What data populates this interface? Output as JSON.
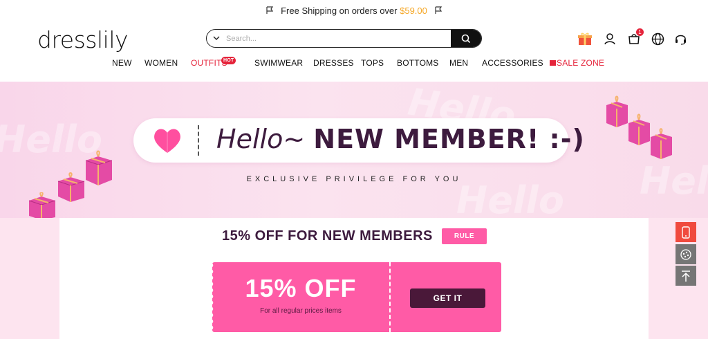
{
  "shipping": {
    "text": "Free Shipping on orders over",
    "amount": "$59.00"
  },
  "header": {
    "logo": "dresslily",
    "search": {
      "placeholder": "Search..."
    },
    "icons": [
      "gift-icon",
      "user-icon",
      "cart-icon",
      "globe-icon",
      "headset-icon"
    ],
    "cart_count": "1"
  },
  "nav": {
    "items": [
      {
        "label": "NEW"
      },
      {
        "label": "WOMEN"
      },
      {
        "label": "OUTFITS",
        "badge": "HOT"
      },
      {
        "label": "SWIMWEAR"
      },
      {
        "label": "DRESSES"
      },
      {
        "label": "TOPS"
      },
      {
        "label": "BOTTOMS"
      },
      {
        "label": "MEN"
      },
      {
        "label": "ACCESSORIES"
      },
      {
        "label": "SALE ZONE"
      }
    ]
  },
  "hero": {
    "hello": "Hello~",
    "headline": "NEW MEMBER! :-)",
    "subtitle": "EXCLUSIVE PRIVILEGE FOR YOU",
    "watermark": "Hello"
  },
  "offer": {
    "title": "15% OFF FOR NEW MEMBERS",
    "rule_label": "RULE",
    "coupon": {
      "amount": "15% OFF",
      "description": "For all regular prices items",
      "cta": "GET IT"
    }
  },
  "colors": {
    "accent_pink": "#ff5ba6",
    "dark_plum": "#3d1b3e",
    "sale_red": "#e5243b",
    "free_shipping_amount": "#f5a623"
  },
  "floating": [
    "mobile-app-icon",
    "chat-icon",
    "back-to-top-icon"
  ]
}
